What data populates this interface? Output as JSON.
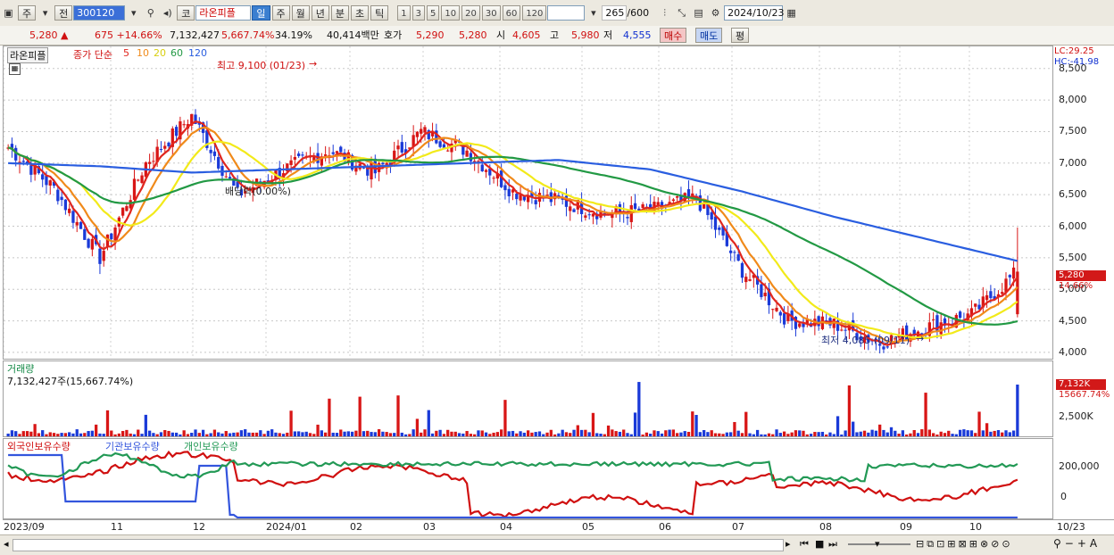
{
  "toolbar": {
    "period_type": "주",
    "prev_label": "전",
    "stock_code": "300120",
    "market_label": "코",
    "stock_name": "라온피플",
    "intervals": [
      "일",
      "주",
      "월",
      "년",
      "분",
      "초",
      "틱"
    ],
    "selected_interval": "일",
    "tick_steps": [
      "1",
      "3",
      "5",
      "10",
      "20",
      "30",
      "60",
      "120"
    ],
    "count_value": "265",
    "count_total": "/600",
    "date_value": "2024/10/23"
  },
  "quote": {
    "price": "5,280 ▲",
    "change": "675 +14.66%",
    "volume": "7,132,427",
    "volume_ratio": "5,667.74%",
    "turnover": "34.19%",
    "amount": "40,414백만",
    "ask_label": "호가",
    "ask1": "5,290",
    "bid1": "5,280",
    "open_label": "시",
    "open": "4,605",
    "high_label": "고",
    "high": "5,980",
    "low_label": "저",
    "low": "4,555",
    "buy_label": "매수",
    "sell_label": "매도",
    "eval_label": "평"
  },
  "price_panel": {
    "name_tag": "라온피플",
    "legend_prefix": "종가 단순",
    "ma_periods": [
      "5",
      "10",
      "20",
      "60",
      "120"
    ],
    "ma_colors": [
      "#e0261e",
      "#f08a1a",
      "#f2ea1a",
      "#229944",
      "#2a5ee0"
    ],
    "lc_label": "LC:29.25",
    "hc_label": "HC:-41.98",
    "high_annotation": "최고 9,100 (01/23)",
    "low_annotation": "최저 4,085 (09/11)",
    "event_label": "배당락(0.00%)",
    "price_tag": "5,280",
    "pct_tag": "14.66%",
    "y_ticks": [
      "8,500",
      "8,000",
      "7,500",
      "7,000",
      "6,500",
      "6,000",
      "5,500",
      "5,000",
      "4,500",
      "4,000"
    ]
  },
  "volume_panel": {
    "title": "거래량",
    "info": "7,132,427주(15,667.74%)",
    "tag1": "7,132K",
    "tag2": "15667.74%",
    "tick": "2,500K"
  },
  "holding_panel": {
    "legends": [
      "외국인보유수량",
      "기관보유수량",
      "개인보유수량"
    ],
    "legend_colors": [
      "#d01010",
      "#3355dd",
      "#229955"
    ],
    "ticks": [
      "200,000",
      "0"
    ]
  },
  "dates": [
    "2023/09",
    "11",
    "12",
    "2024/01",
    "02",
    "03",
    "04",
    "05",
    "06",
    "07",
    "08",
    "09",
    "10",
    "10/23"
  ],
  "chart_data": {
    "type": "candlestick",
    "title": "",
    "ylim": [
      3900,
      8850
    ],
    "y_ticks": [
      4000,
      4500,
      5000,
      5500,
      6000,
      6500,
      7000,
      7500,
      8000,
      8500
    ],
    "x": [
      "2023/09",
      "11",
      "12",
      "2024/01",
      "02",
      "03",
      "04",
      "05",
      "06",
      "07",
      "08",
      "09",
      "10",
      "10/23"
    ],
    "close_keypoints": [
      7250,
      6600,
      5500,
      7000,
      7750,
      6500,
      6900,
      7200,
      6850,
      7500,
      7200,
      6550,
      6400,
      6200,
      6250,
      6450,
      5300,
      4500,
      4450,
      4150,
      4400,
      4600,
      5280
    ],
    "ma120_keypoints": [
      7000,
      6950,
      6850,
      6900,
      6950,
      7000,
      7050,
      6900,
      6550,
      6150,
      5800,
      5450
    ],
    "high_annotation": {
      "value": 9100,
      "date": "01/23"
    },
    "low_annotation": {
      "value": 4085,
      "date": "09/11"
    },
    "last": {
      "open": 4605,
      "high": 5980,
      "low": 4555,
      "close": 5280
    }
  }
}
